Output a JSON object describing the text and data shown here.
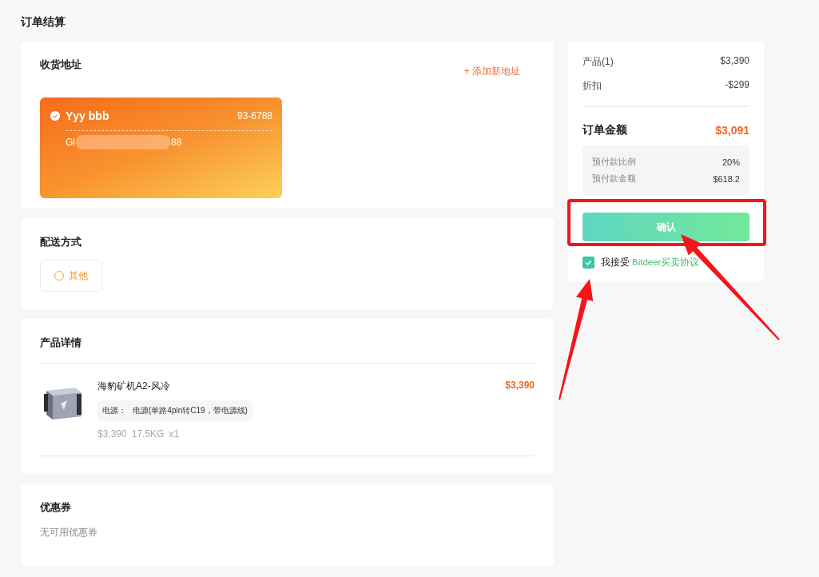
{
  "page_title": "订单结算",
  "address_section": {
    "title": "收货地址",
    "add_link": "+ 添加新地址",
    "addresses": [
      {
        "name": "Yyy bbb",
        "phone": "93-6788",
        "address_start": "Gl",
        "address_end": "88",
        "selected": true,
        "redacted": true
      }
    ]
  },
  "delivery_section": {
    "title": "配送方式",
    "options": [
      {
        "label": "其他",
        "selected": false
      }
    ]
  },
  "product_section": {
    "title": "产品详情",
    "items": [
      {
        "kind": "picture",
        "name": "海豹矿机A2-风冷",
        "price": "$3,390",
        "spec_label": "电源：",
        "spec_value": "电源(单路4pin转C19，带电源线)",
        "unit_price": "$3,390",
        "weight": "17.5KG",
        "quantity": "x1"
      }
    ]
  },
  "coupon_section": {
    "title": "优惠券",
    "empty_text": "无可用优惠券"
  },
  "summary": {
    "rows": [
      {
        "label": "产品(1)",
        "value": "$3,390"
      },
      {
        "label": "折扣",
        "value": "-$299"
      }
    ],
    "total_label": "订单金额",
    "total_value": "$3,091",
    "prepay_rows": [
      {
        "label": "预付款比例",
        "value": "20%"
      },
      {
        "label": "预付款金额",
        "value": "$618.2"
      }
    ],
    "confirm_button": "确认",
    "agreement": {
      "checked": true,
      "text": "我接受",
      "link": "Bitdeer买卖协议"
    }
  },
  "annotations": [
    {
      "kind": "box"
    },
    {
      "kind": "arrow"
    },
    {
      "kind": "arrow"
    }
  ]
}
